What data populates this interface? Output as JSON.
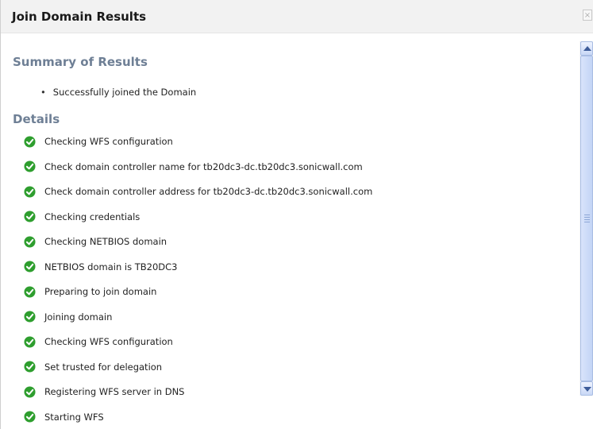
{
  "dialog": {
    "title": "Join Domain Results",
    "close_glyph": "×"
  },
  "summary": {
    "heading": "Summary of Results",
    "items": [
      "Successfully joined the Domain"
    ]
  },
  "details": {
    "heading": "Details",
    "status_icon": "check-circle-icon",
    "status_color": "#2e9e2e",
    "steps": [
      "Checking WFS configuration",
      "Check domain controller name for tb20dc3-dc.tb20dc3.sonicwall.com",
      "Check domain controller address for tb20dc3-dc.tb20dc3.sonicwall.com",
      "Checking credentials",
      "Checking NETBIOS domain",
      "NETBIOS domain is TB20DC3",
      "Preparing to join domain",
      "Joining domain",
      "Checking WFS configuration",
      "Set trusted for delegation",
      "Registering WFS server in DNS",
      "Starting WFS"
    ]
  },
  "colors": {
    "heading": "#6e7f95",
    "scrollbar_accent": "#c3d4f5"
  }
}
